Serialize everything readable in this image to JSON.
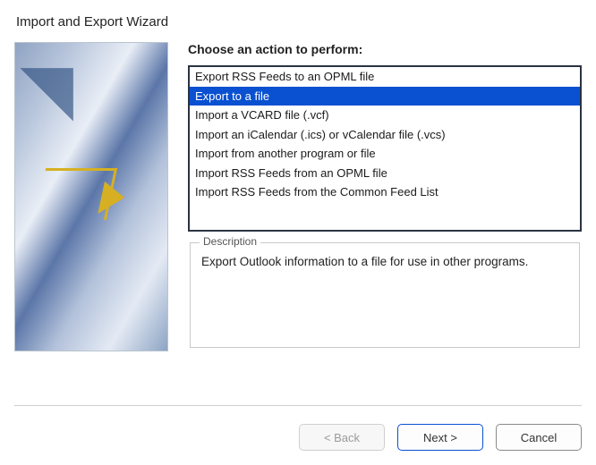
{
  "title": "Import and Export Wizard",
  "prompt": "Choose an action to perform:",
  "actions": [
    {
      "label": "Export RSS Feeds to an OPML file",
      "selected": false
    },
    {
      "label": "Export to a file",
      "selected": true
    },
    {
      "label": "Import a VCARD file (.vcf)",
      "selected": false
    },
    {
      "label": "Import an iCalendar (.ics) or vCalendar file (.vcs)",
      "selected": false
    },
    {
      "label": "Import from another program or file",
      "selected": false
    },
    {
      "label": "Import RSS Feeds from an OPML file",
      "selected": false
    },
    {
      "label": "Import RSS Feeds from the Common Feed List",
      "selected": false
    }
  ],
  "description": {
    "label": "Description",
    "text": "Export Outlook information to a file for use in other programs."
  },
  "buttons": {
    "back": "< Back",
    "next": "Next >",
    "cancel": "Cancel"
  }
}
